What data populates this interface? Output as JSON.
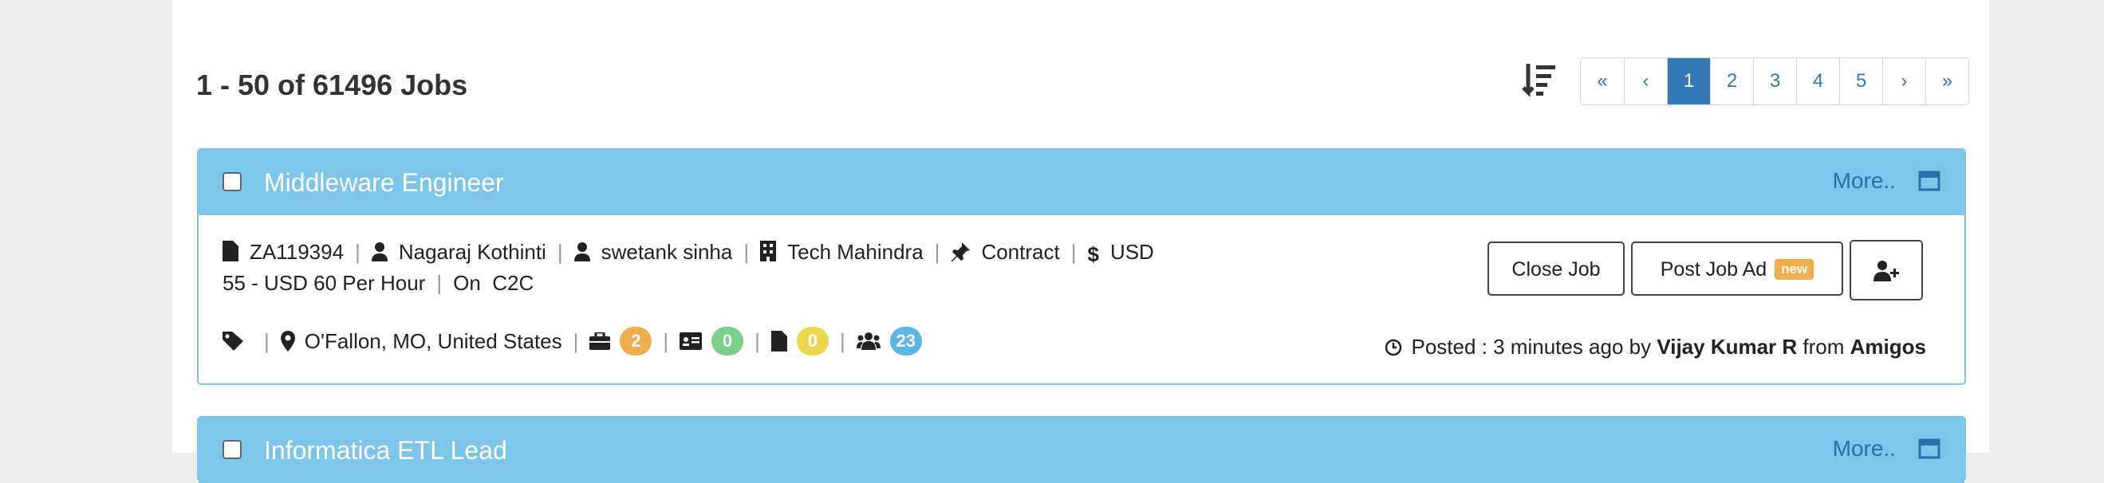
{
  "results": {
    "count_label": "1 - 50 of 61496 Jobs"
  },
  "pagination": {
    "first": "«",
    "prev": "‹",
    "pages": [
      "1",
      "2",
      "3",
      "4",
      "5"
    ],
    "active_page": "1",
    "next": "›",
    "last": "»"
  },
  "jobs": [
    {
      "title": "Middleware Engineer",
      "more_label": "More..",
      "job_id": "ZA119394",
      "recruiter": "Nagaraj Kothinti",
      "owner": "swetank sinha",
      "client": "Tech Mahindra",
      "job_type": "Contract",
      "currency": "USD",
      "rate_line": "55 - USD 60 Per Hour",
      "on_label": "On",
      "tax_term": "C2C",
      "location": "O'Fallon, MO, United States",
      "counts": {
        "submissions": "2",
        "interviews": "0",
        "documents": "0",
        "applicants": "23"
      },
      "buttons": {
        "close_job": "Close Job",
        "post_job_ad": "Post Job Ad",
        "new_badge": "new"
      },
      "posted_prefix": "Posted : 3 minutes ago by",
      "posted_by": "Vijay Kumar R",
      "from_label": "from",
      "posted_from": "Amigos"
    },
    {
      "title": "Informatica ETL Lead",
      "more_label": "More.."
    }
  ],
  "colors": {
    "header_blue": "#7dc6ea",
    "link_blue": "#337ab7",
    "badge_orange": "#f0ad4e",
    "badge_green": "#7ccf8a",
    "badge_yellow": "#ebd84c",
    "badge_blue": "#5bb8e6"
  },
  "icons": [
    "sort-amount-down-icon",
    "window-maximize-icon",
    "file-icon",
    "user-icon",
    "building-icon",
    "thumbtack-icon",
    "dollar-icon",
    "tag-icon",
    "map-marker-icon",
    "briefcase-icon",
    "id-card-icon",
    "users-icon",
    "clock-icon",
    "user-plus-icon"
  ]
}
